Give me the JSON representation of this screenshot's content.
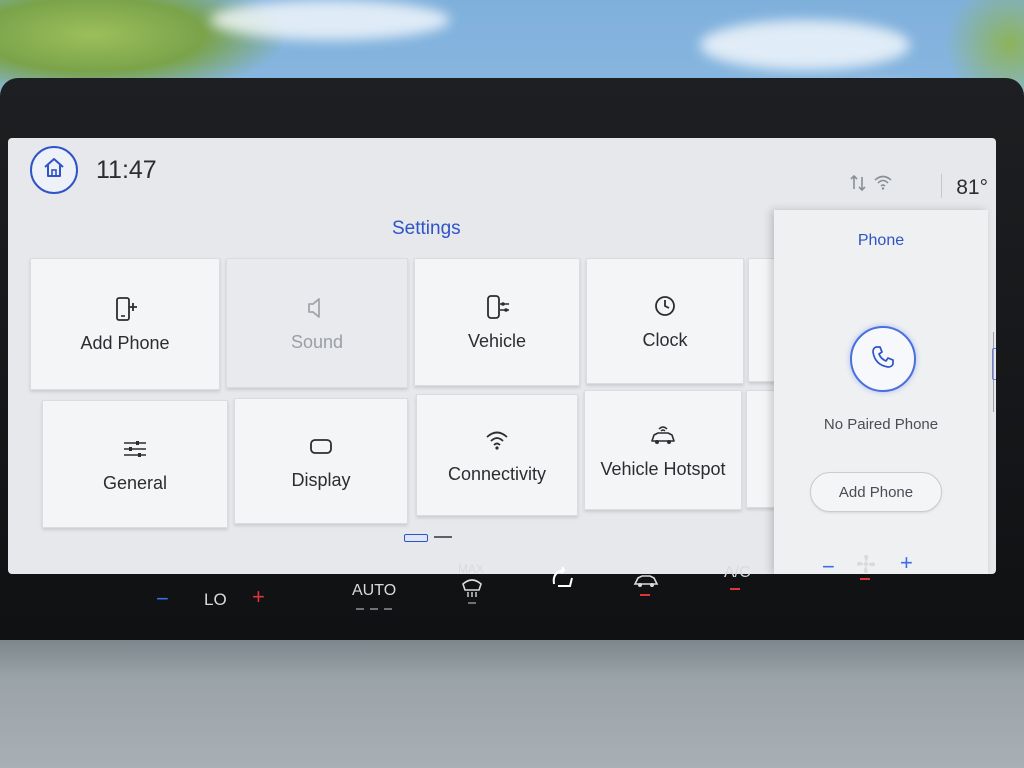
{
  "status": {
    "time": "11:47",
    "temperature": "81°"
  },
  "settings": {
    "title": "Settings",
    "tiles": [
      {
        "label": "Add Phone",
        "icon": "add-phone-icon",
        "enabled": true
      },
      {
        "label": "Sound",
        "icon": "speaker-icon",
        "enabled": false
      },
      {
        "label": "Vehicle",
        "icon": "vehicle-settings-icon",
        "enabled": true
      },
      {
        "label": "Clock",
        "icon": "clock-icon",
        "enabled": true
      },
      {
        "label": "General",
        "icon": "sliders-icon",
        "enabled": true
      },
      {
        "label": "Display",
        "icon": "display-icon",
        "enabled": true
      },
      {
        "label": "Connectivity",
        "icon": "wifi-icon",
        "enabled": true
      },
      {
        "label": "Vehicle Hotspot",
        "icon": "vehicle-hotspot-icon",
        "enabled": true
      }
    ]
  },
  "phone_panel": {
    "title": "Phone",
    "status": "No Paired Phone",
    "button_label": "Add Phone"
  },
  "climate": {
    "driver_temp": "LO",
    "auto_label": "AUTO",
    "max_defrost_label": "MAX",
    "ac_label": "A/C",
    "accent_cool": "#3a6ee8",
    "accent_warm": "#e0343a"
  },
  "colors": {
    "accent": "#2e54c8",
    "screen_bg": "#e6e8ec"
  }
}
